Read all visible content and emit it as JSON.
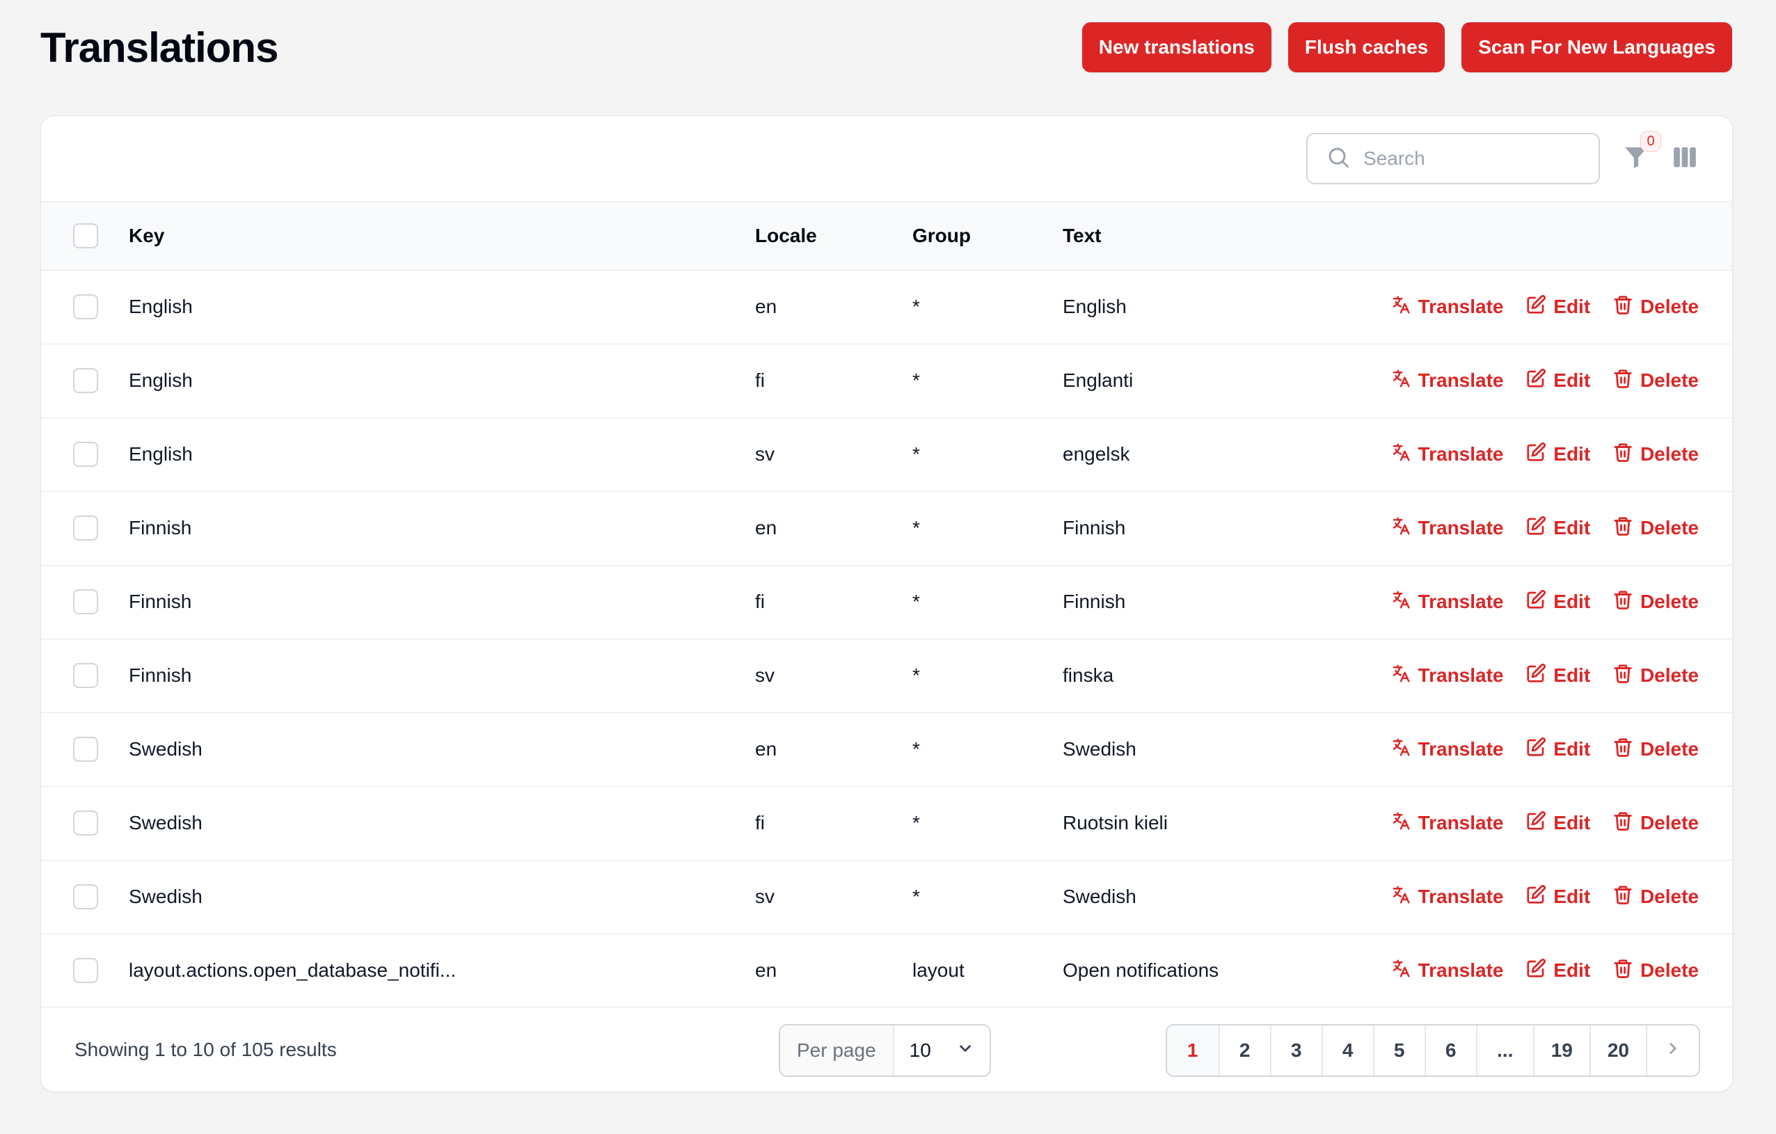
{
  "page_title": "Translations",
  "header_buttons": {
    "new_translations": "New translations",
    "flush_caches": "Flush caches",
    "scan_languages": "Scan For New Languages"
  },
  "toolbar": {
    "search_placeholder": "Search",
    "filter_count": "0"
  },
  "table": {
    "headers": {
      "key": "Key",
      "locale": "Locale",
      "group": "Group",
      "text": "Text"
    },
    "action_labels": {
      "translate": "Translate",
      "edit": "Edit",
      "delete": "Delete"
    },
    "rows": [
      {
        "key": "English",
        "locale": "en",
        "group": "*",
        "text": "English"
      },
      {
        "key": "English",
        "locale": "fi",
        "group": "*",
        "text": "Englanti"
      },
      {
        "key": "English",
        "locale": "sv",
        "group": "*",
        "text": "engelsk"
      },
      {
        "key": "Finnish",
        "locale": "en",
        "group": "*",
        "text": "Finnish"
      },
      {
        "key": "Finnish",
        "locale": "fi",
        "group": "*",
        "text": "Finnish"
      },
      {
        "key": "Finnish",
        "locale": "sv",
        "group": "*",
        "text": "finska"
      },
      {
        "key": "Swedish",
        "locale": "en",
        "group": "*",
        "text": "Swedish"
      },
      {
        "key": "Swedish",
        "locale": "fi",
        "group": "*",
        "text": "Ruotsin kieli"
      },
      {
        "key": "Swedish",
        "locale": "sv",
        "group": "*",
        "text": "Swedish"
      },
      {
        "key": "layout.actions.open_database_notifi...",
        "locale": "en",
        "group": "layout",
        "text": "Open notifications"
      }
    ]
  },
  "footer": {
    "results_text": "Showing 1 to 10 of 105 results",
    "per_page_label": "Per page",
    "per_page_value": "10",
    "pages": [
      "1",
      "2",
      "3",
      "4",
      "5",
      "6",
      "...",
      "19",
      "20"
    ],
    "active_page": "1"
  },
  "colors": {
    "accent": "#dc2626",
    "background": "#f4f4f5"
  },
  "icons": [
    "search-icon",
    "filter-icon",
    "columns-icon",
    "translate-icon",
    "edit-icon",
    "trash-icon",
    "chevron-down-icon",
    "chevron-right-icon"
  ]
}
